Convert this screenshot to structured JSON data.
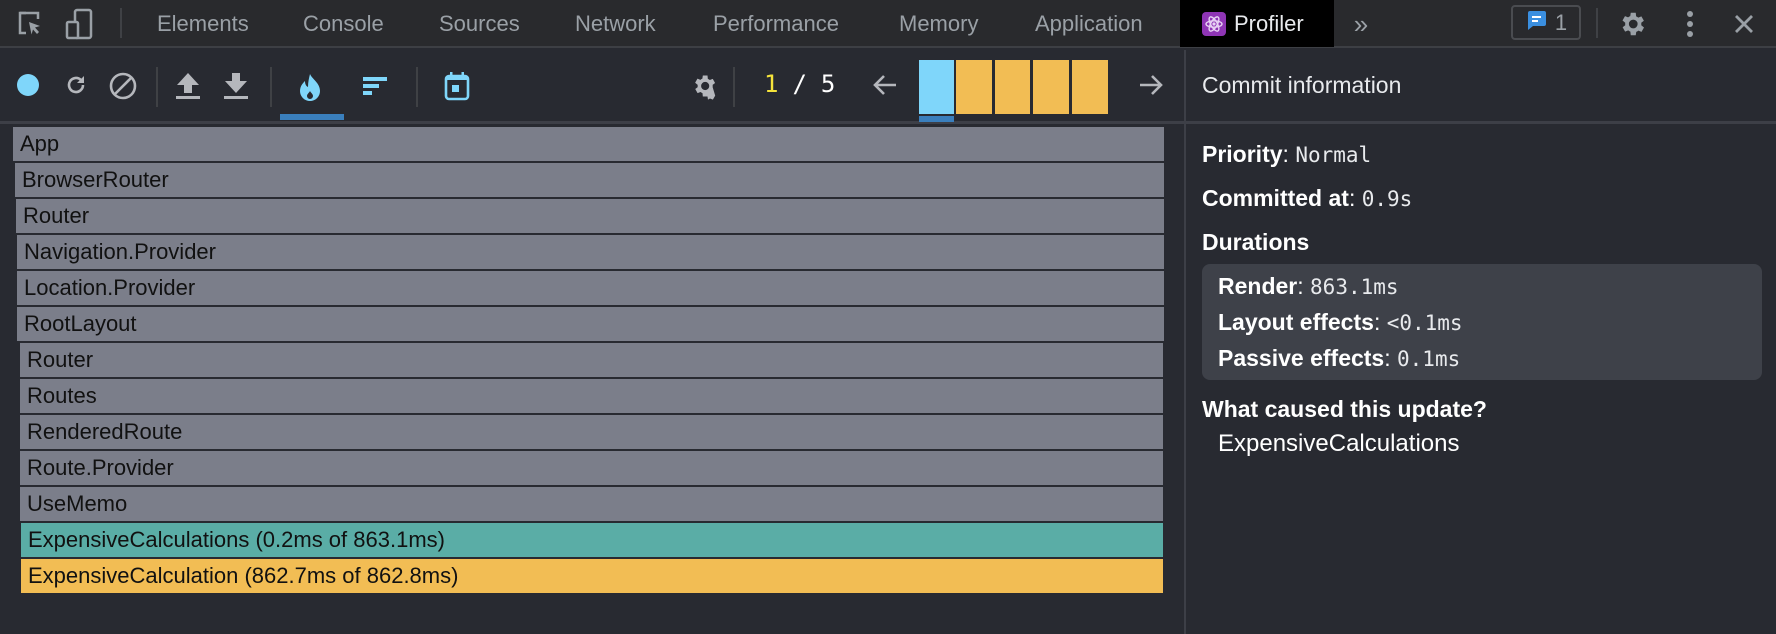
{
  "devtools": {
    "tabs": [
      {
        "label": "Elements"
      },
      {
        "label": "Console"
      },
      {
        "label": "Sources"
      },
      {
        "label": "Network"
      },
      {
        "label": "Performance"
      },
      {
        "label": "Memory"
      },
      {
        "label": "Application"
      },
      {
        "label": "Profiler",
        "active": true
      }
    ],
    "issues_count": "1",
    "icons": [
      "inspect-element-icon",
      "device-toggle-icon",
      "more-tabs-icon",
      "issues-icon",
      "settings-icon",
      "kebab-menu-icon",
      "close-icon"
    ]
  },
  "profiler": {
    "toolbar": {
      "icons": [
        "record-icon",
        "reload-and-profile-icon",
        "clear-icon",
        "load-profile-icon",
        "save-profile-icon",
        "flamegraph-icon",
        "ranked-chart-icon",
        "timeline-icon",
        "settings-icon"
      ],
      "active_view": "flamegraph",
      "commit_current": "1",
      "commit_separator": "/",
      "commit_total": "5"
    },
    "commits": [
      {
        "index": 1,
        "color": "#7fd6fa",
        "selected": true
      },
      {
        "index": 2,
        "color": "#f2bd54",
        "selected": false
      },
      {
        "index": 3,
        "color": "#f2bd54",
        "selected": false
      },
      {
        "index": 4,
        "color": "#f2bd54",
        "selected": false
      },
      {
        "index": 5,
        "color": "#f2bd54",
        "selected": false
      }
    ],
    "flamegraph": [
      {
        "label": "App",
        "depth": 0,
        "color": "#7b7e8a"
      },
      {
        "label": "BrowserRouter",
        "depth": 1,
        "color": "#7b7e8a"
      },
      {
        "label": "Router",
        "depth": 2,
        "color": "#7b7e8a"
      },
      {
        "label": "Navigation.Provider",
        "depth": 3,
        "color": "#7b7e8a"
      },
      {
        "label": "Location.Provider",
        "depth": 4,
        "color": "#7b7e8a"
      },
      {
        "label": "RootLayout",
        "depth": 5,
        "color": "#7b7e8a"
      },
      {
        "label": "Router",
        "depth": 6,
        "color": "#7b7e8a"
      },
      {
        "label": "Routes",
        "depth": 7,
        "color": "#7b7e8a"
      },
      {
        "label": "RenderedRoute",
        "depth": 8,
        "color": "#7b7e8a"
      },
      {
        "label": "Route.Provider",
        "depth": 9,
        "color": "#7b7e8a"
      },
      {
        "label": "UseMemo",
        "depth": 10,
        "color": "#7b7e8a"
      },
      {
        "label": "ExpensiveCalculations (0.2ms of 863.1ms)",
        "depth": 11,
        "color": "#5aada6"
      },
      {
        "label": "ExpensiveCalculation (862.7ms of 862.8ms)",
        "depth": 12,
        "color": "#f2bd54"
      }
    ],
    "commit_info": {
      "title": "Commit information",
      "priority_label": "Priority",
      "priority_value": "Normal",
      "committed_label": "Committed at",
      "committed_value": "0.9s",
      "durations_label": "Durations",
      "render_label": "Render",
      "render_value": "863.1ms",
      "layout_label": "Layout effects",
      "layout_value": "<0.1ms",
      "passive_label": "Passive effects",
      "passive_value": "0.1ms",
      "cause_label": "What caused this update?",
      "cause_value": "ExpensiveCalculations"
    }
  }
}
